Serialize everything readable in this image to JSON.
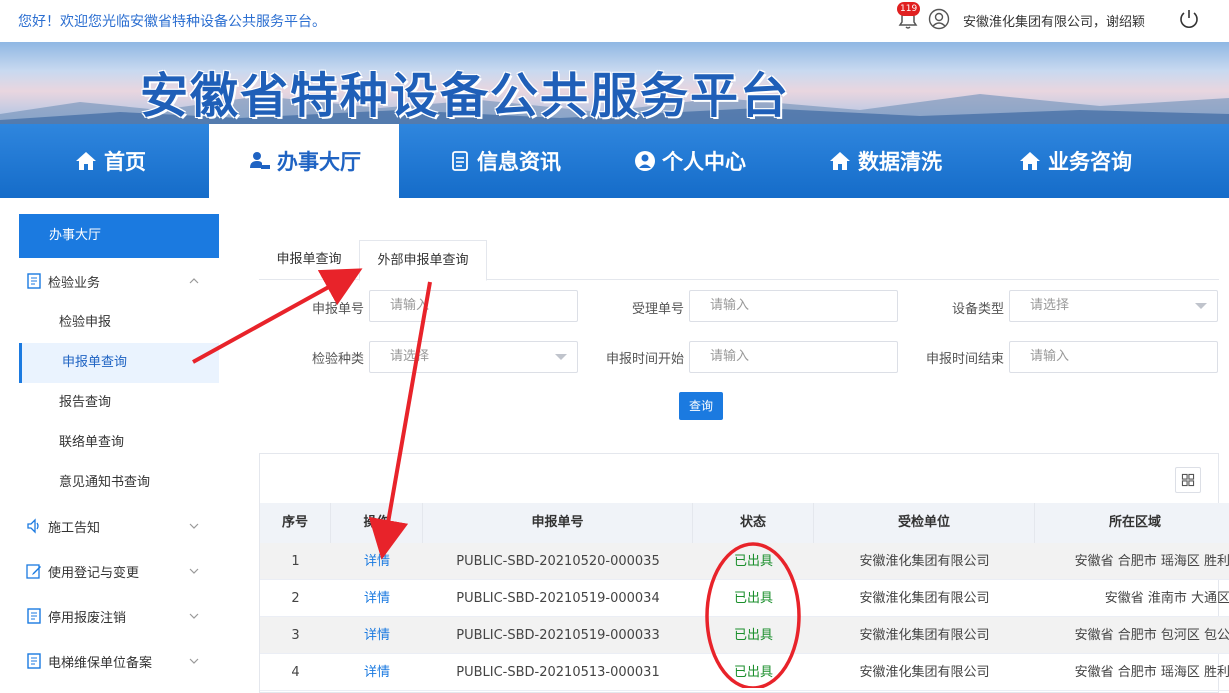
{
  "topbar": {
    "welcome": "您好！欢迎您光临安徽省特种设备公共服务平台。",
    "notification_count": "119",
    "user": "安徽淮化集团有限公司，谢绍颖"
  },
  "banner": {
    "title": "安徽省特种设备公共服务平台"
  },
  "nav": {
    "items": [
      {
        "label": "首页",
        "icon": "home-icon"
      },
      {
        "label": "办事大厅",
        "icon": "service-hall-icon"
      },
      {
        "label": "信息资讯",
        "icon": "news-icon"
      },
      {
        "label": "个人中心",
        "icon": "user-icon"
      },
      {
        "label": "数据清洗",
        "icon": "home-icon"
      },
      {
        "label": "业务咨询",
        "icon": "home-icon"
      }
    ],
    "active": "办事大厅"
  },
  "sidebar": {
    "header": "办事大厅",
    "groups": [
      {
        "label": "检验业务",
        "icon": "document-icon",
        "expanded": true
      },
      {
        "label": "施工告知",
        "icon": "speaker-icon"
      },
      {
        "label": "使用登记与变更",
        "icon": "edit-icon"
      },
      {
        "label": "停用报废注销",
        "icon": "document-icon"
      },
      {
        "label": "电梯维保单位备案",
        "icon": "document-icon"
      }
    ],
    "subitems": [
      {
        "label": "检验申报"
      },
      {
        "label": "申报单查询",
        "active": true
      },
      {
        "label": "报告查询"
      },
      {
        "label": "联络单查询"
      },
      {
        "label": "意见通知书查询"
      }
    ]
  },
  "tabs": [
    {
      "label": "申报单查询"
    },
    {
      "label": "外部申报单查询",
      "active": true
    }
  ],
  "filters": {
    "apply_no": {
      "label": "申报单号",
      "placeholder": "请输入"
    },
    "accept_no": {
      "label": "受理单号",
      "placeholder": "请输入"
    },
    "device_type": {
      "label": "设备类型",
      "placeholder": "请选择"
    },
    "inspect_kind": {
      "label": "检验种类",
      "placeholder": "请选择"
    },
    "start_time": {
      "label": "申报时间开始",
      "placeholder": "请输入"
    },
    "end_time": {
      "label": "申报时间结束",
      "placeholder": "请输入"
    },
    "query_button": "查询"
  },
  "table": {
    "columns": [
      "序号",
      "操作",
      "申报单号",
      "状态",
      "受检单位",
      "所在区域"
    ],
    "rows": [
      {
        "no": "1",
        "action": "详情",
        "apply_no": "PUBLIC-SBD-20210520-000035",
        "status": "已出具",
        "unit": "安徽淮化集团有限公司",
        "region": "安徽省 合肥市 瑶海区 胜利"
      },
      {
        "no": "2",
        "action": "详情",
        "apply_no": "PUBLIC-SBD-20210519-000034",
        "status": "已出具",
        "unit": "安徽淮化集团有限公司",
        "region": "安徽省 淮南市 大通区"
      },
      {
        "no": "3",
        "action": "详情",
        "apply_no": "PUBLIC-SBD-20210519-000033",
        "status": "已出具",
        "unit": "安徽淮化集团有限公司",
        "region": "安徽省 合肥市 包河区 包公"
      },
      {
        "no": "4",
        "action": "详情",
        "apply_no": "PUBLIC-SBD-20210513-000031",
        "status": "已出具",
        "unit": "安徽淮化集团有限公司",
        "region": "安徽省 合肥市 瑶海区 胜利"
      }
    ]
  },
  "annotation_color": "#e8232a"
}
